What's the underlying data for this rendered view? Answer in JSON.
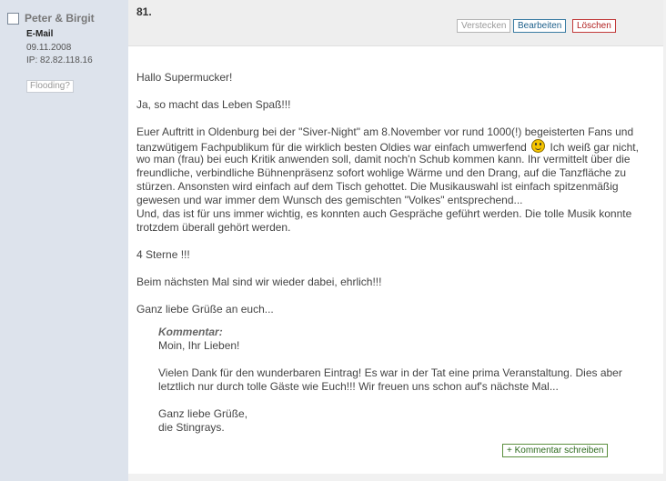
{
  "sidebar": {
    "author": "Peter & Birgit",
    "email_label": "E-Mail",
    "date": "09.11.2008",
    "ip": "IP: 82.82.118.16",
    "flooding_label": "Flooding?"
  },
  "entry": {
    "number": "81.",
    "buttons": {
      "hide": "Verstecken",
      "edit": "Bearbeiten",
      "delete": "Löschen"
    }
  },
  "message": {
    "greeting": "Hallo Supermucker!",
    "line2": "Ja, so macht das Leben Spaß!!!",
    "para_lines": [
      "Euer Auftritt in Oldenburg bei der \"Siver-Night\" am 8.November vor rund 1000(!) begeisterten Fans und",
      "tanzwütigem Fachpublikum für die wirklich besten Oldies war einfach umwerfend",
      "Ich weiß gar nicht,",
      "wo man (frau) bei euch Kritik anwenden soll, damit noch'n Schub kommen kann. Ihr vermittelt über die",
      "freundliche, verbindliche Bühnenpräsenz sofort wohlige Wärme und den Drang, auf die Tanzfläche zu",
      "stürzen. Ansonsten wird einfach auf dem Tisch gehottet. Die Musikauswahl ist einfach spitzenmäßig",
      "gewesen und war immer dem Wunsch des gemischten \"Volkes\" entsprechend...",
      "Und, das ist für uns immer wichtig, es konnten auch Gespräche geführt werden. Die tolle Musik konnte",
      "trotzdem überall gehört werden."
    ],
    "stars": "4 Sterne !!!",
    "next_time": "Beim nächsten Mal sind wir wieder dabei, ehrlich!!!",
    "closing": "Ganz liebe Grüße an euch..."
  },
  "comment": {
    "label": "Kommentar",
    "colon": ":",
    "lines": [
      "Moin, Ihr Lieben!",
      "Vielen Dank für den wunderbaren Eintrag! Es war in der Tat eine prima Veranstaltung. Dies aber",
      "letztlich nur durch tolle Gäste wie Euch!!! Wir freuen uns schon auf's nächste Mal...",
      "Ganz liebe Grüße,",
      "die Stingrays."
    ],
    "add_button": "+ Kommentar schreiben"
  },
  "icons": {
    "smiley": "smiley-icon"
  }
}
